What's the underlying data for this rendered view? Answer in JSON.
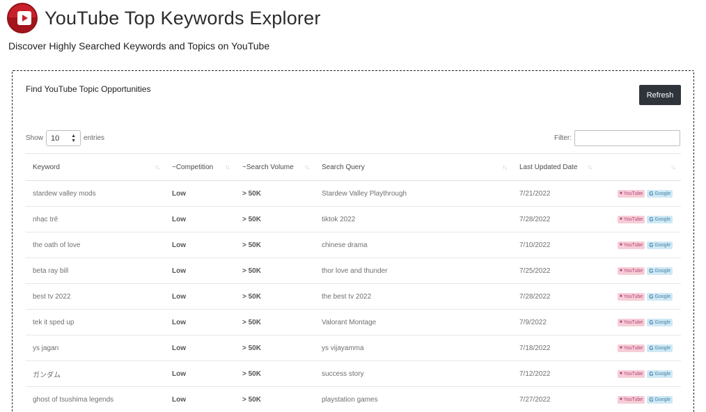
{
  "app": {
    "title": "YouTube Top Keywords Explorer",
    "tagline": "Discover Highly Searched Keywords and Topics on YouTube"
  },
  "panel": {
    "title": "Find YouTube Topic Opportunities",
    "refresh_label": "Refresh"
  },
  "controls": {
    "show_label": "Show",
    "entries_value": "10",
    "entries_label": "entries",
    "filter_label": "Filter:"
  },
  "table": {
    "columns": [
      "Keyword",
      "~Competition",
      "~Search Volume",
      "Search Query",
      "Last Updated Date",
      ""
    ],
    "badges": {
      "youtube": "YouTube",
      "google": "Google"
    },
    "rows": [
      {
        "keyword": "stardew valley mods",
        "competition": "Low",
        "volume": "> 50K",
        "query": "Stardew Valley Playthrough",
        "date": "7/21/2022"
      },
      {
        "keyword": "nhạc trẻ",
        "competition": "Low",
        "volume": "> 50K",
        "query": "tiktok 2022",
        "date": "7/28/2022"
      },
      {
        "keyword": "the oath of love",
        "competition": "Low",
        "volume": "> 50K",
        "query": "chinese drama",
        "date": "7/10/2022"
      },
      {
        "keyword": "beta ray bill",
        "competition": "Low",
        "volume": "> 50K",
        "query": "thor love and thunder",
        "date": "7/25/2022"
      },
      {
        "keyword": "best tv 2022",
        "competition": "Low",
        "volume": "> 50K",
        "query": "the best tv 2022",
        "date": "7/28/2022"
      },
      {
        "keyword": "tek it sped up",
        "competition": "Low",
        "volume": "> 50K",
        "query": "Valorant Montage",
        "date": "7/9/2022"
      },
      {
        "keyword": "ys jagan",
        "competition": "Low",
        "volume": "> 50K",
        "query": "ys vijayamma",
        "date": "7/18/2022"
      },
      {
        "keyword": "ガンダム",
        "competition": "Low",
        "volume": "> 50K",
        "query": "success story",
        "date": "7/12/2022"
      },
      {
        "keyword": "ghost of tsushima legends",
        "competition": "Low",
        "volume": "> 50K",
        "query": "playstation games",
        "date": "7/27/2022"
      }
    ]
  },
  "colors": {
    "logo_red": "#c8202a",
    "button_dark": "#2f343b",
    "youtube_badge_bg": "#f6cdd6",
    "google_badge_bg": "#cfe9f5"
  },
  "icons": {
    "logo": "youtube-play-icon",
    "sort": "sort-arrows-icon",
    "select": "select-arrows-icon"
  }
}
